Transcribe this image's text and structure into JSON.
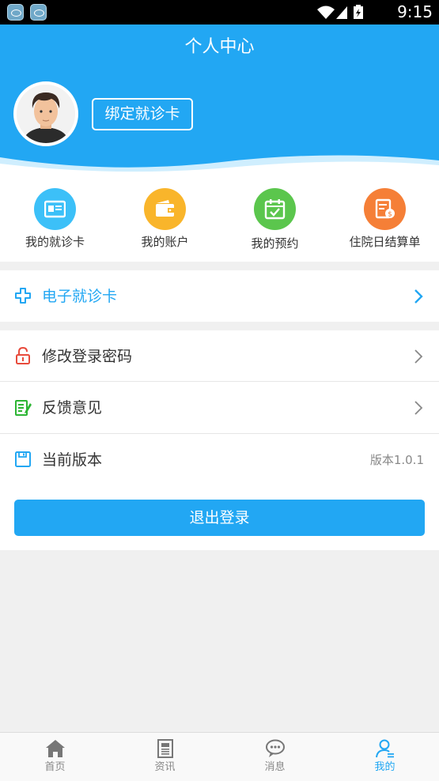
{
  "status_bar": {
    "time": "9:15"
  },
  "header": {
    "title": "个人中心",
    "bind_card_label": "绑定就诊卡"
  },
  "quick_actions": [
    {
      "label": "我的就诊卡",
      "icon": "id-card-icon",
      "color": "#3cc0f8"
    },
    {
      "label": "我的账户",
      "icon": "wallet-icon",
      "color": "#f9b52b"
    },
    {
      "label": "我的预约",
      "icon": "calendar-check-icon",
      "color": "#5bc64d"
    },
    {
      "label": "住院日结算单",
      "icon": "bill-icon",
      "color": "#f57f37"
    }
  ],
  "menu": {
    "e_card": {
      "label": "电子就诊卡",
      "icon": "medical-cross-icon"
    },
    "change_password": {
      "label": "修改登录密码",
      "icon": "lock-icon"
    },
    "feedback": {
      "label": "反馈意见",
      "icon": "edit-note-icon"
    },
    "version": {
      "label": "当前版本",
      "value": "版本1.0.1",
      "icon": "save-icon"
    }
  },
  "logout_label": "退出登录",
  "tabs": [
    {
      "label": "首页",
      "icon": "home-icon"
    },
    {
      "label": "资讯",
      "icon": "news-icon"
    },
    {
      "label": "消息",
      "icon": "message-icon"
    },
    {
      "label": "我的",
      "icon": "user-icon",
      "active": true
    }
  ],
  "colors": {
    "primary": "#22a7f3",
    "lock": "#e84b3c",
    "feedback": "#2db534"
  }
}
